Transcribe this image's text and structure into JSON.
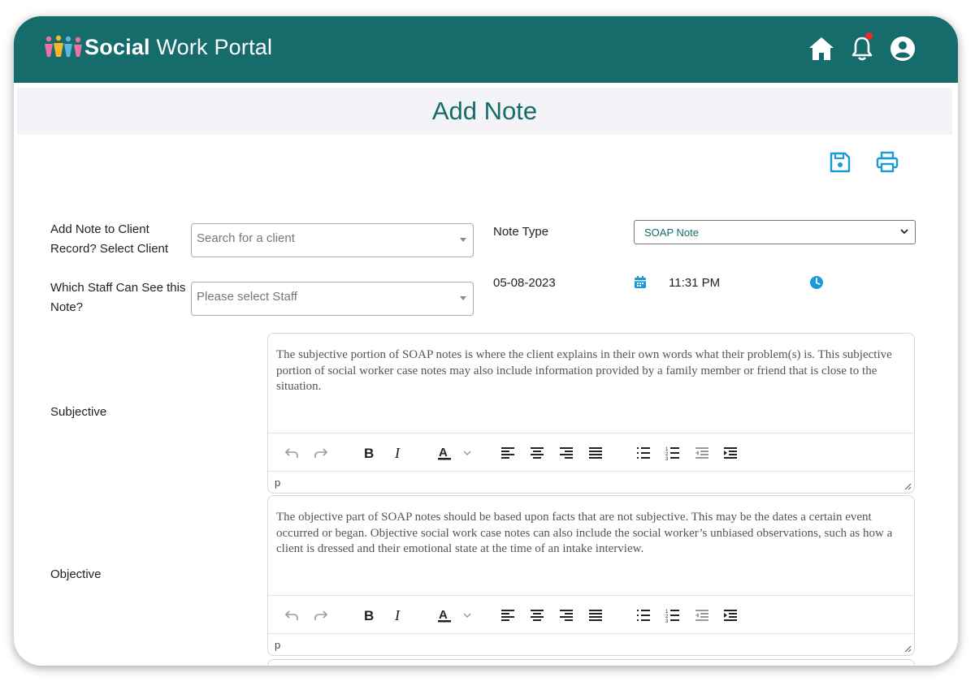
{
  "header": {
    "logo_bold": "Social",
    "logo_rest": "Work Portal",
    "icons": [
      "home-icon",
      "bell-icon",
      "user-account-icon"
    ],
    "brand_color": "#166b6b",
    "notification_color": "#e52d27"
  },
  "page": {
    "title": "Add Note",
    "actions": [
      "save-icon",
      "print-icon"
    ],
    "action_color": "#1a9bd7"
  },
  "form": {
    "client_label": "Add Note to Client Record? Select Client",
    "client_placeholder": "Search for a client",
    "staff_label": "Which Staff Can See this Note?",
    "staff_placeholder": "Please select Staff",
    "note_type_label": "Note Type",
    "note_type_value": "SOAP Note",
    "date_value": "05-08-2023",
    "time_value": "11:31 PM"
  },
  "editors": [
    {
      "label": "Subjective",
      "content": "The subjective portion of SOAP notes is where the client explains in their own words what their problem(s) is. This subjective portion of social worker case notes may also include information provided by a family member or friend that is close to the situation.",
      "status": "p"
    },
    {
      "label": "Objective",
      "content": "The objective part of SOAP notes should be based upon facts that are not subjective. This may be the dates a certain event occurred or began. Objective social work case notes can also include the social worker’s unbiased observations, such as how a client is dressed and their emotional state at the time of an intake interview.",
      "status": "p"
    }
  ],
  "toolbar_icons": [
    "undo-icon",
    "redo-icon",
    "bold-icon",
    "italic-icon",
    "text-color-icon",
    "align-left-icon",
    "align-center-icon",
    "align-right-icon",
    "align-justify-icon",
    "bullet-list-icon",
    "numbered-list-icon",
    "outdent-icon",
    "indent-icon"
  ]
}
